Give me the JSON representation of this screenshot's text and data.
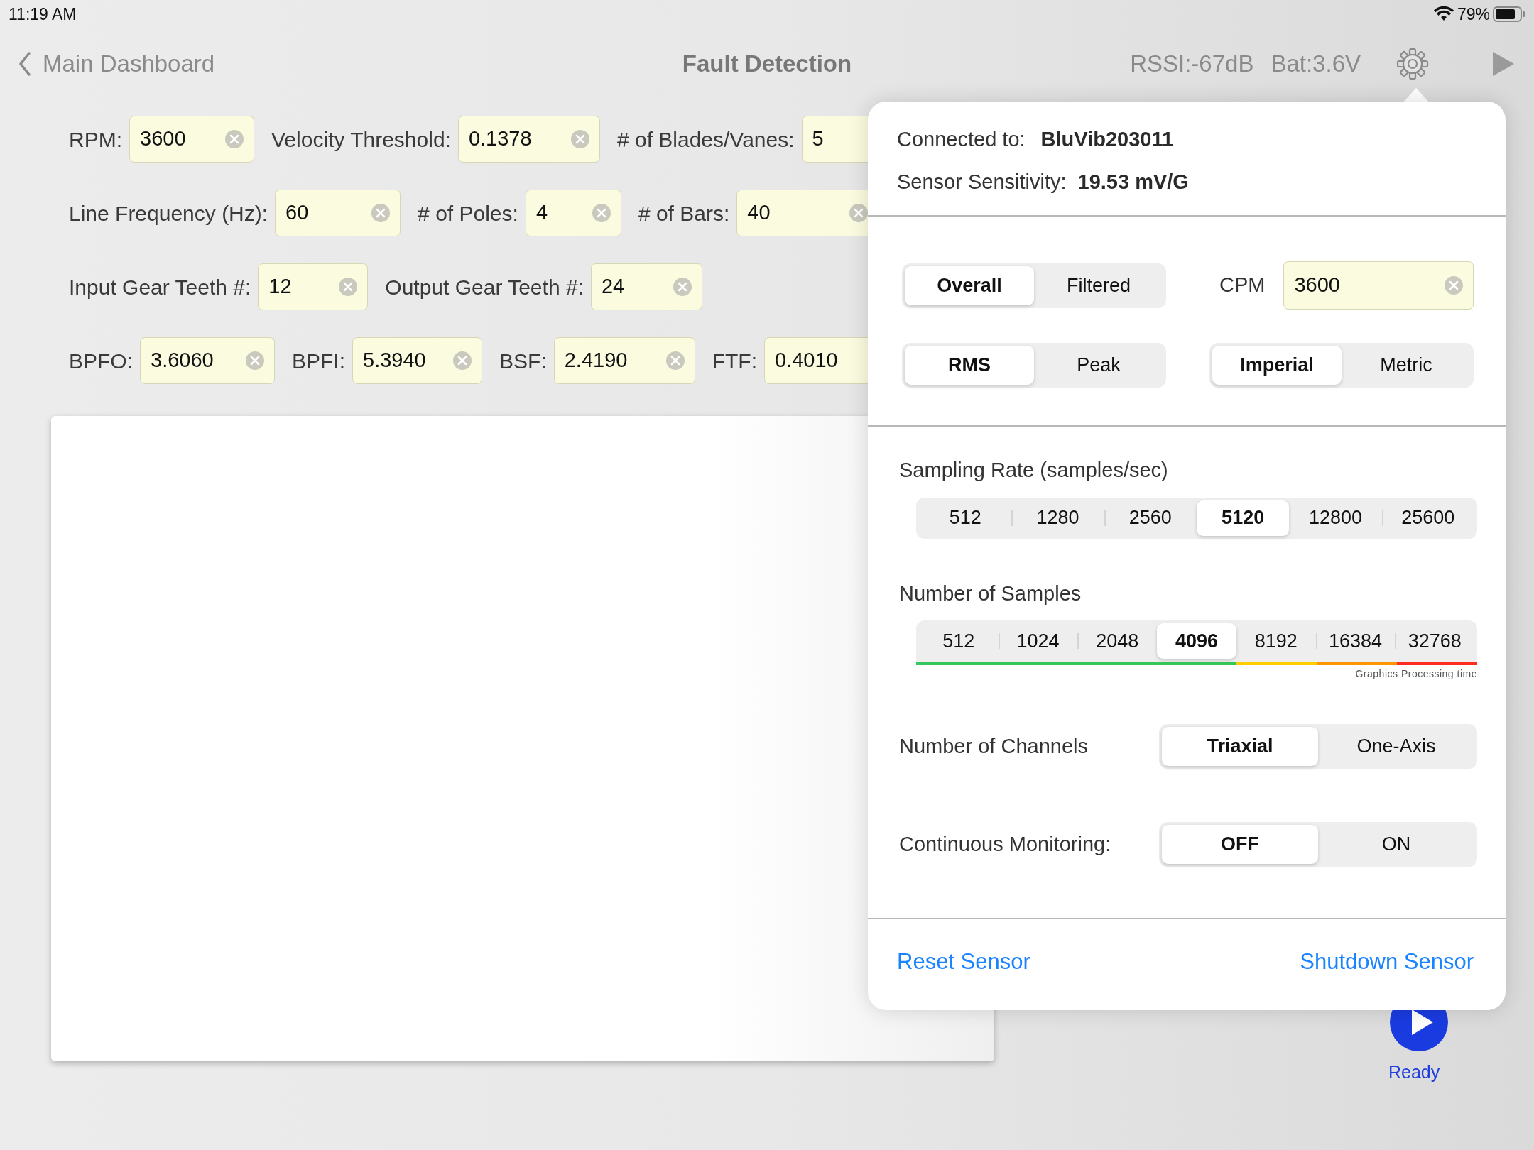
{
  "status_bar": {
    "time": "11:19 AM",
    "battery": "79%"
  },
  "nav": {
    "back": "Main Dashboard",
    "title": "Fault Detection",
    "rssi": "RSSI:-67dB",
    "voltage": "Bat:3.6V"
  },
  "params": [
    [
      {
        "label": "RPM:",
        "value": "3600"
      },
      {
        "label": "Velocity Threshold:",
        "value": "0.1378"
      },
      {
        "label": "# of Blades/Vanes:",
        "value": "5"
      }
    ],
    [
      {
        "label": "Line Frequency (Hz):",
        "value": "60"
      },
      {
        "label": "# of Poles:",
        "value": "4"
      },
      {
        "label": "# of Bars:",
        "value": "40"
      }
    ],
    [
      {
        "label": "Input Gear Teeth #:",
        "value": "12"
      },
      {
        "label": "Output Gear Teeth #:",
        "value": "24"
      }
    ],
    [
      {
        "label": "BPFO:",
        "value": "3.6060"
      },
      {
        "label": "BPFI:",
        "value": "5.3940"
      },
      {
        "label": "BSF:",
        "value": "2.4190"
      },
      {
        "label": "FTF:",
        "value": "0.4010"
      }
    ]
  ],
  "popover": {
    "connected_label": "Connected to:",
    "connected_value": "BluVib203011",
    "sensitivity_label": "Sensor Sensitivity:",
    "sensitivity_value": "19.53 mV/G",
    "mode": [
      {
        "label": "Overall",
        "selected": true
      },
      {
        "label": "Filtered",
        "selected": false
      }
    ],
    "cpm": {
      "label": "CPM",
      "value": "3600"
    },
    "measure": [
      {
        "label": "RMS",
        "selected": true
      },
      {
        "label": "Peak",
        "selected": false
      }
    ],
    "units": [
      {
        "label": "Imperial",
        "selected": true
      },
      {
        "label": "Metric",
        "selected": false
      }
    ],
    "sampling_rate": {
      "label": "Sampling Rate (samples/sec)",
      "options": [
        {
          "label": "512",
          "selected": false
        },
        {
          "label": "1280",
          "selected": false
        },
        {
          "label": "2560",
          "selected": false
        },
        {
          "label": "5120",
          "selected": true
        },
        {
          "label": "12800",
          "selected": false
        },
        {
          "label": "25600",
          "selected": false
        }
      ]
    },
    "samples": {
      "label": "Number of Samples",
      "legend": "Graphics Processing time",
      "options": [
        {
          "label": "512",
          "selected": false,
          "color": "#34c759"
        },
        {
          "label": "1024",
          "selected": false,
          "color": "#34c759"
        },
        {
          "label": "2048",
          "selected": false,
          "color": "#34c759"
        },
        {
          "label": "4096",
          "selected": true,
          "color": "#34c759"
        },
        {
          "label": "8192",
          "selected": false,
          "color": "#ffcc00"
        },
        {
          "label": "16384",
          "selected": false,
          "color": "#ff9500"
        },
        {
          "label": "32768",
          "selected": false,
          "color": "#ff2d20"
        }
      ]
    },
    "channels": {
      "label": "Number of Channels",
      "options": [
        {
          "label": "Triaxial",
          "selected": true
        },
        {
          "label": "One-Axis",
          "selected": false
        }
      ]
    },
    "monitoring": {
      "label": "Continuous Monitoring:",
      "options": [
        {
          "label": "OFF",
          "selected": true
        },
        {
          "label": "ON",
          "selected": false
        }
      ]
    },
    "actions": [
      "Reset Sensor",
      "Shutdown Sensor"
    ]
  },
  "run": {
    "status": "Ready"
  }
}
